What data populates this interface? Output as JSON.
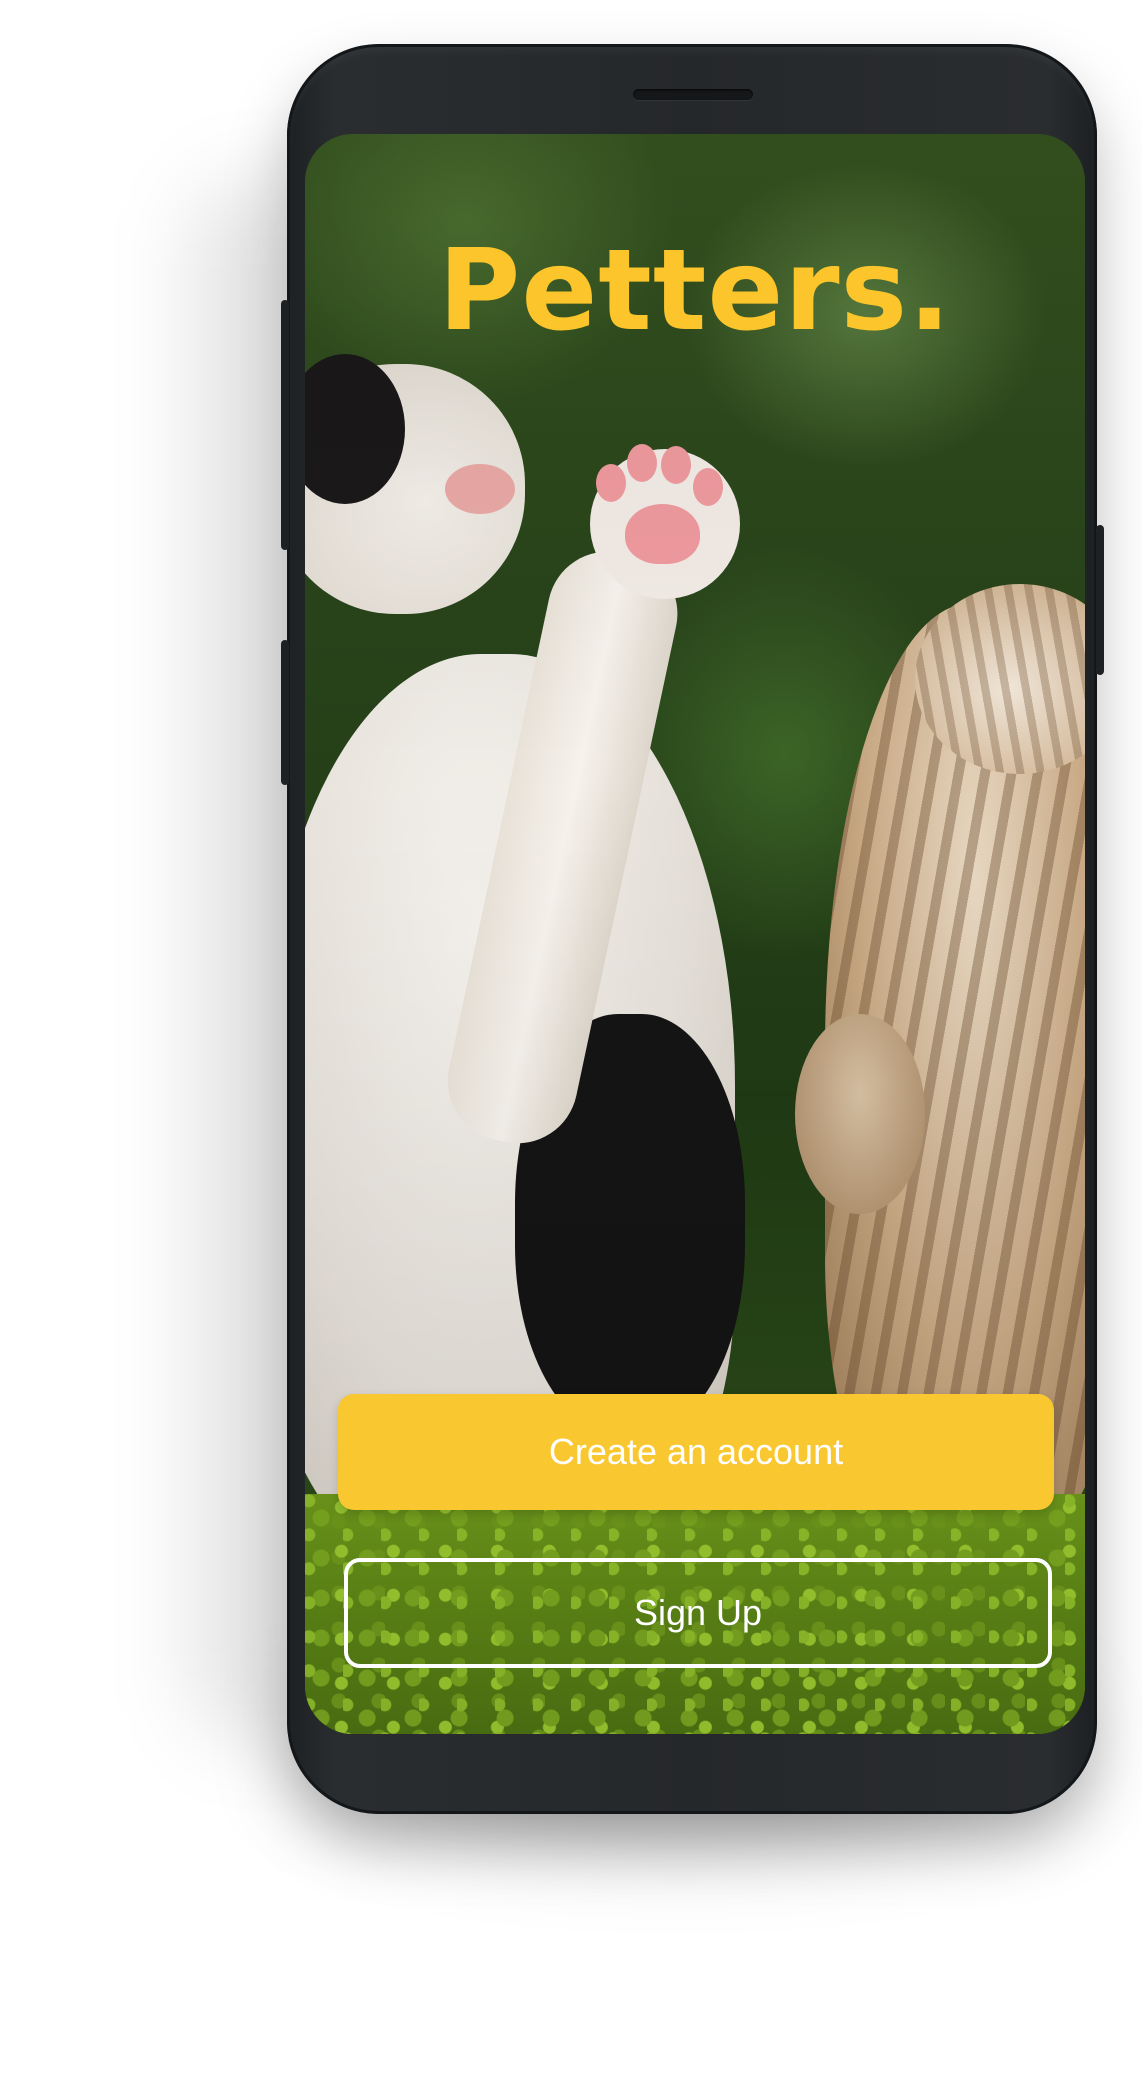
{
  "app": {
    "title": "Petters."
  },
  "actions": {
    "create_account_label": "Create an account",
    "sign_up_label": "Sign Up"
  },
  "colors": {
    "brand_yellow": "#f9c72f",
    "title_yellow": "#fbc52b",
    "phone_body": "#25282b",
    "button_text": "#ffffff"
  }
}
